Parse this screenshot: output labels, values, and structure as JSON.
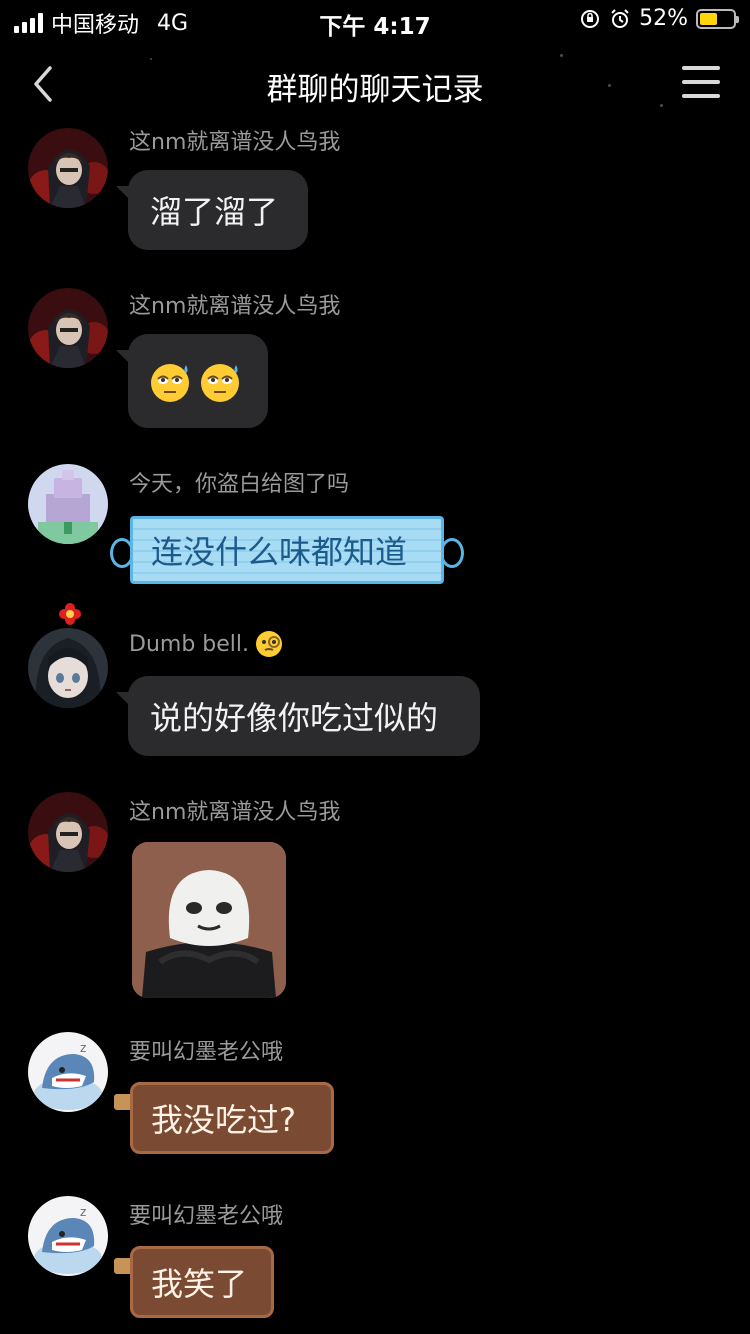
{
  "status_bar": {
    "carrier": "中国移动",
    "network": "4G",
    "time": "下午 4:17",
    "battery_percent": "52%",
    "battery_level": 0.52,
    "icons": [
      "signal-icon",
      "rotation-lock-icon",
      "alarm-icon",
      "battery-icon"
    ]
  },
  "nav": {
    "title": "群聊的聊天记录",
    "back_icon": "chevron-left-icon",
    "menu_icon": "hamburger-menu-icon"
  },
  "messages": [
    {
      "sender": "这nm就离谱没人鸟我",
      "text": "溜了溜了",
      "style": "plain"
    },
    {
      "sender": "这nm就离谱没人鸟我",
      "text": "",
      "style": "emoji",
      "emoji": [
        "sweat-roll-eyes-emoji",
        "sweat-roll-eyes-emoji"
      ]
    },
    {
      "sender": "今天，你盗白给图了吗",
      "text": "连没什么味都知道",
      "style": "mask-bubble"
    },
    {
      "sender": "Dumb bell.",
      "text": "说的好像你吃过似的",
      "style": "plain",
      "sender_emoji": "monocle-face-emoji"
    },
    {
      "sender": "这nm就离谱没人鸟我",
      "text": "",
      "style": "sticker",
      "sticker": "panda-head-meme-sticker"
    },
    {
      "sender": "要叫幻墨老公哦",
      "text": "我没吃过?",
      "style": "chocolate-bubble"
    },
    {
      "sender": "要叫幻墨老公哦",
      "text": "我笑了",
      "style": "chocolate-bubble"
    }
  ],
  "colors": {
    "background": "#000000",
    "bubble": "#2b2b2d",
    "sender_text": "#9a9a9a",
    "battery": "#ffd60a",
    "mask_bubble": "#a8dcf5",
    "chocolate_bubble": "#7a4a32"
  }
}
